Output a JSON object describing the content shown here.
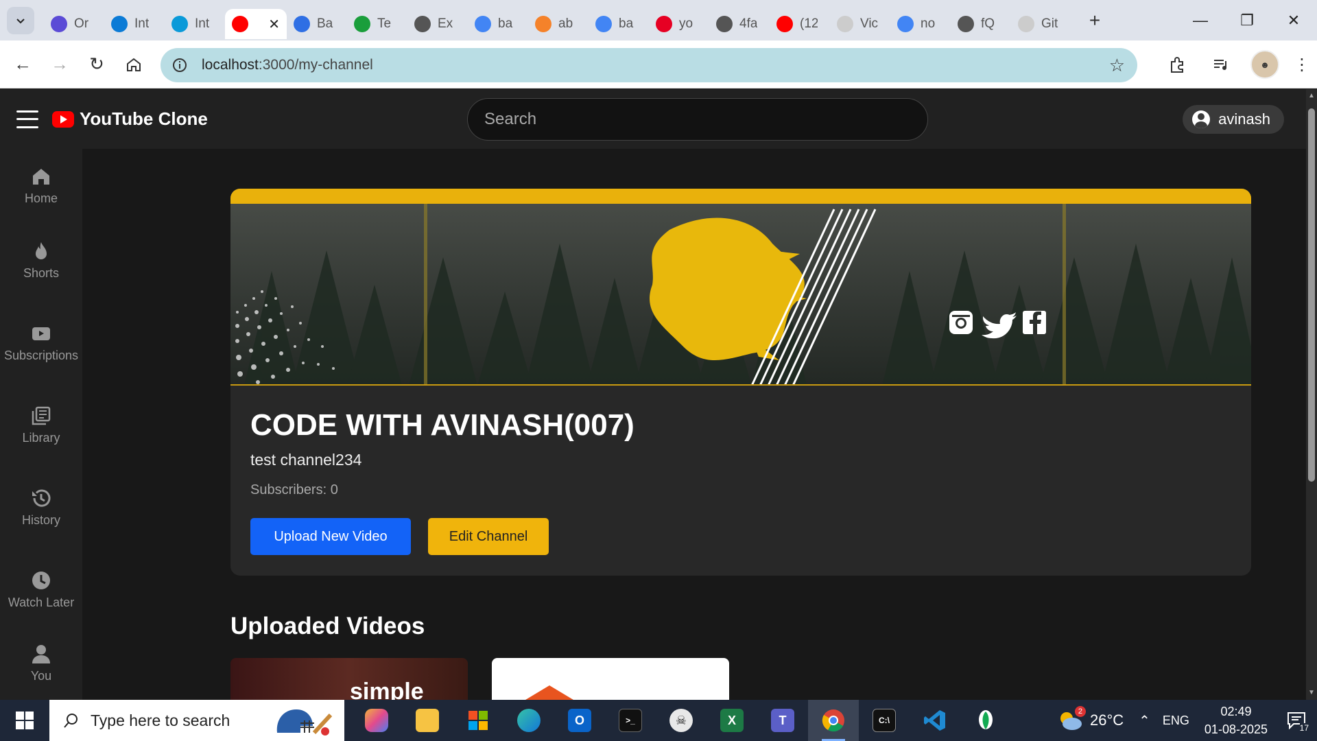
{
  "browser": {
    "tabs": [
      {
        "label": "Or",
        "icon": "circle-icon",
        "color": "#5b4bd6"
      },
      {
        "label": "Int",
        "icon": "is-icon",
        "color": "#0b7bd6"
      },
      {
        "label": "Int",
        "icon": "ist-icon",
        "color": "#0a9ad9"
      },
      {
        "label": "",
        "icon": "youtube-icon",
        "color": "#ff0000",
        "active": true
      },
      {
        "label": "Ba",
        "icon": "doc-icon",
        "color": "#2f6fe4"
      },
      {
        "label": "Te",
        "icon": "tc-icon",
        "color": "#1a9e3b"
      },
      {
        "label": "Ex",
        "icon": "globe-icon",
        "color": "#555555"
      },
      {
        "label": "ba",
        "icon": "google-icon",
        "color": "#4285f4"
      },
      {
        "label": "ab",
        "icon": "orange-icon",
        "color": "#f5822a"
      },
      {
        "label": "ba",
        "icon": "google-icon",
        "color": "#4285f4"
      },
      {
        "label": "yo",
        "icon": "pinterest-icon",
        "color": "#e60023"
      },
      {
        "label": "4fa",
        "icon": "globe-icon",
        "color": "#555555"
      },
      {
        "label": "(12",
        "icon": "youtube-icon",
        "color": "#ff0000"
      },
      {
        "label": "Vic",
        "icon": "openai-icon",
        "color": "#cccccc"
      },
      {
        "label": "no",
        "icon": "google-icon",
        "color": "#4285f4"
      },
      {
        "label": "fQ",
        "icon": "globe-icon",
        "color": "#555555"
      },
      {
        "label": "Git",
        "icon": "github-icon",
        "color": "#cccccc"
      }
    ],
    "url_host": "localhost",
    "url_path": ":3000/my-channel"
  },
  "header": {
    "logo_text": "YouTube Clone",
    "search_placeholder": "Search",
    "username": "avinash"
  },
  "sidebar": {
    "items": [
      {
        "label": "Home",
        "icon": "home-icon"
      },
      {
        "label": "Shorts",
        "icon": "flame-icon"
      },
      {
        "label": "Subscriptions",
        "icon": "subscriptions-icon"
      },
      {
        "label": "Library",
        "icon": "library-icon"
      },
      {
        "label": "History",
        "icon": "history-icon"
      },
      {
        "label": "Watch Later",
        "icon": "clock-icon"
      },
      {
        "label": "You",
        "icon": "user-icon"
      }
    ]
  },
  "channel": {
    "name": "CODE WITH AVINASH(007)",
    "description": "test channel234",
    "subscribers": "Subscribers: 0",
    "upload_button": "Upload New Video",
    "edit_button": "Edit Channel"
  },
  "videos": {
    "section_title": "Uploaded Videos",
    "thumb1_text": "simple"
  },
  "taskbar": {
    "search_placeholder": "Type here to search",
    "weather_temp": "26°C",
    "weather_badge": "2",
    "language": "ENG",
    "time": "02:49",
    "date": "01-08-2025",
    "notification_count": "17"
  },
  "colors": {
    "accent_blue": "#1363f7",
    "accent_yellow": "#f0b40c",
    "youtube_red": "#ff0000"
  }
}
